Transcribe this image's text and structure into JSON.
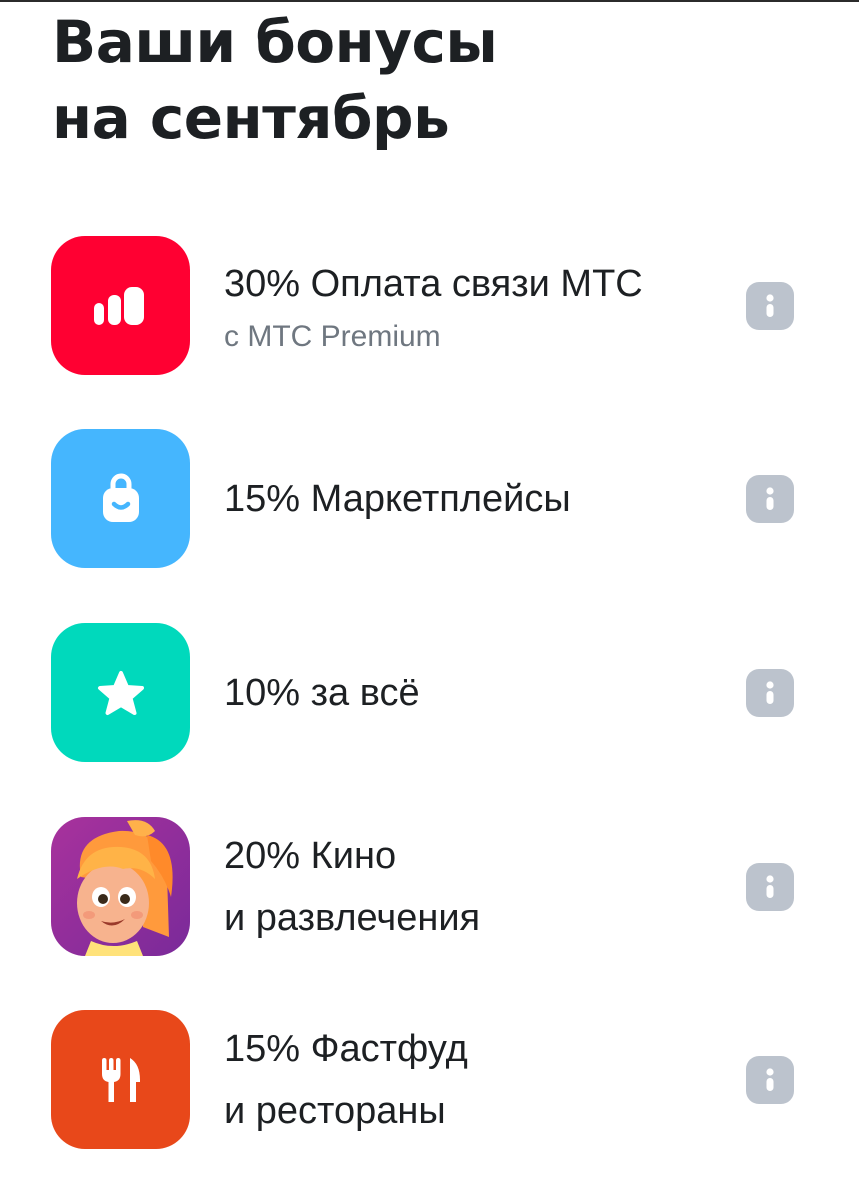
{
  "header": {
    "title_line1": "Ваши бонусы",
    "title_line2": "на сентябрь"
  },
  "colors": {
    "mts_red": "#ff0032",
    "market_blue": "#45b6fe",
    "all_teal": "#00d9bc",
    "movies_purple": "#8f2f9f",
    "food_orange": "#e8481a",
    "info_gray": "#bcc3cd"
  },
  "bonuses": [
    {
      "line1": "30% Оплата связи МТС",
      "subtitle": "с МТС Premium",
      "icon": "signal-bars-icon"
    },
    {
      "line1": "15% Маркетплейсы",
      "icon": "shopping-bag-icon"
    },
    {
      "line1": "10% за всё",
      "icon": "star-icon"
    },
    {
      "line1": "20% Кино",
      "line2": "и развлечения",
      "icon": "cartoon-character-icon"
    },
    {
      "line1": "15% Фастфуд",
      "line2": "и рестораны",
      "icon": "fork-knife-icon"
    }
  ]
}
